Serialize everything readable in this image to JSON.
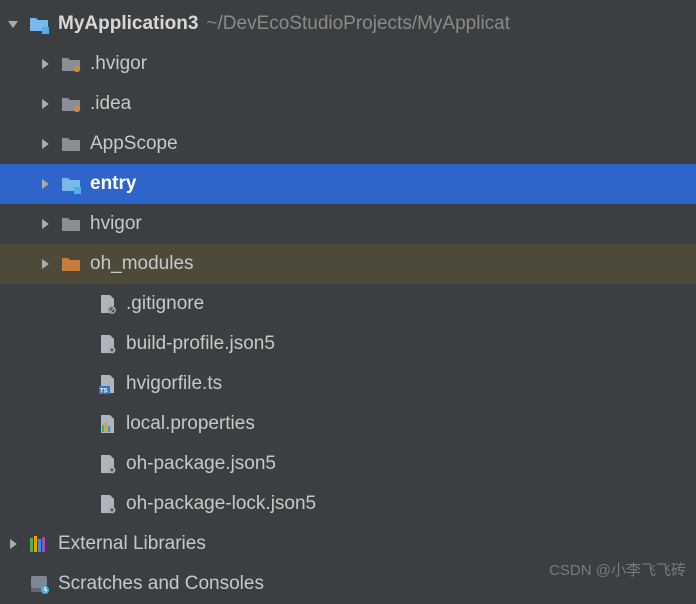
{
  "project": {
    "name": "MyApplication3",
    "path": "~/DevEcoStudioProjects/MyApplicat"
  },
  "tree": {
    "children": [
      {
        "label": ".hvigor",
        "icon": "folder-dot",
        "expandable": true
      },
      {
        "label": ".idea",
        "icon": "folder-dot",
        "expandable": true
      },
      {
        "label": "AppScope",
        "icon": "folder",
        "expandable": true
      },
      {
        "label": "entry",
        "icon": "module",
        "expandable": true,
        "selected": true
      },
      {
        "label": "hvigor",
        "icon": "folder",
        "expandable": true
      },
      {
        "label": "oh_modules",
        "icon": "library-folder",
        "expandable": true,
        "highlighted": true
      },
      {
        "label": ".gitignore",
        "icon": "file-ignore",
        "expandable": false
      },
      {
        "label": "build-profile.json5",
        "icon": "json-gear",
        "expandable": false
      },
      {
        "label": "hvigorfile.ts",
        "icon": "ts-file",
        "expandable": false
      },
      {
        "label": "local.properties",
        "icon": "properties",
        "expandable": false
      },
      {
        "label": "oh-package.json5",
        "icon": "json-gear",
        "expandable": false
      },
      {
        "label": "oh-package-lock.json5",
        "icon": "json-gear",
        "expandable": false
      }
    ]
  },
  "topLevel": [
    {
      "label": "External Libraries",
      "icon": "external-libs",
      "expandable": true
    },
    {
      "label": "Scratches and Consoles",
      "icon": "scratches",
      "expandable": false
    }
  ],
  "watermark": "CSDN @小李飞飞砖"
}
